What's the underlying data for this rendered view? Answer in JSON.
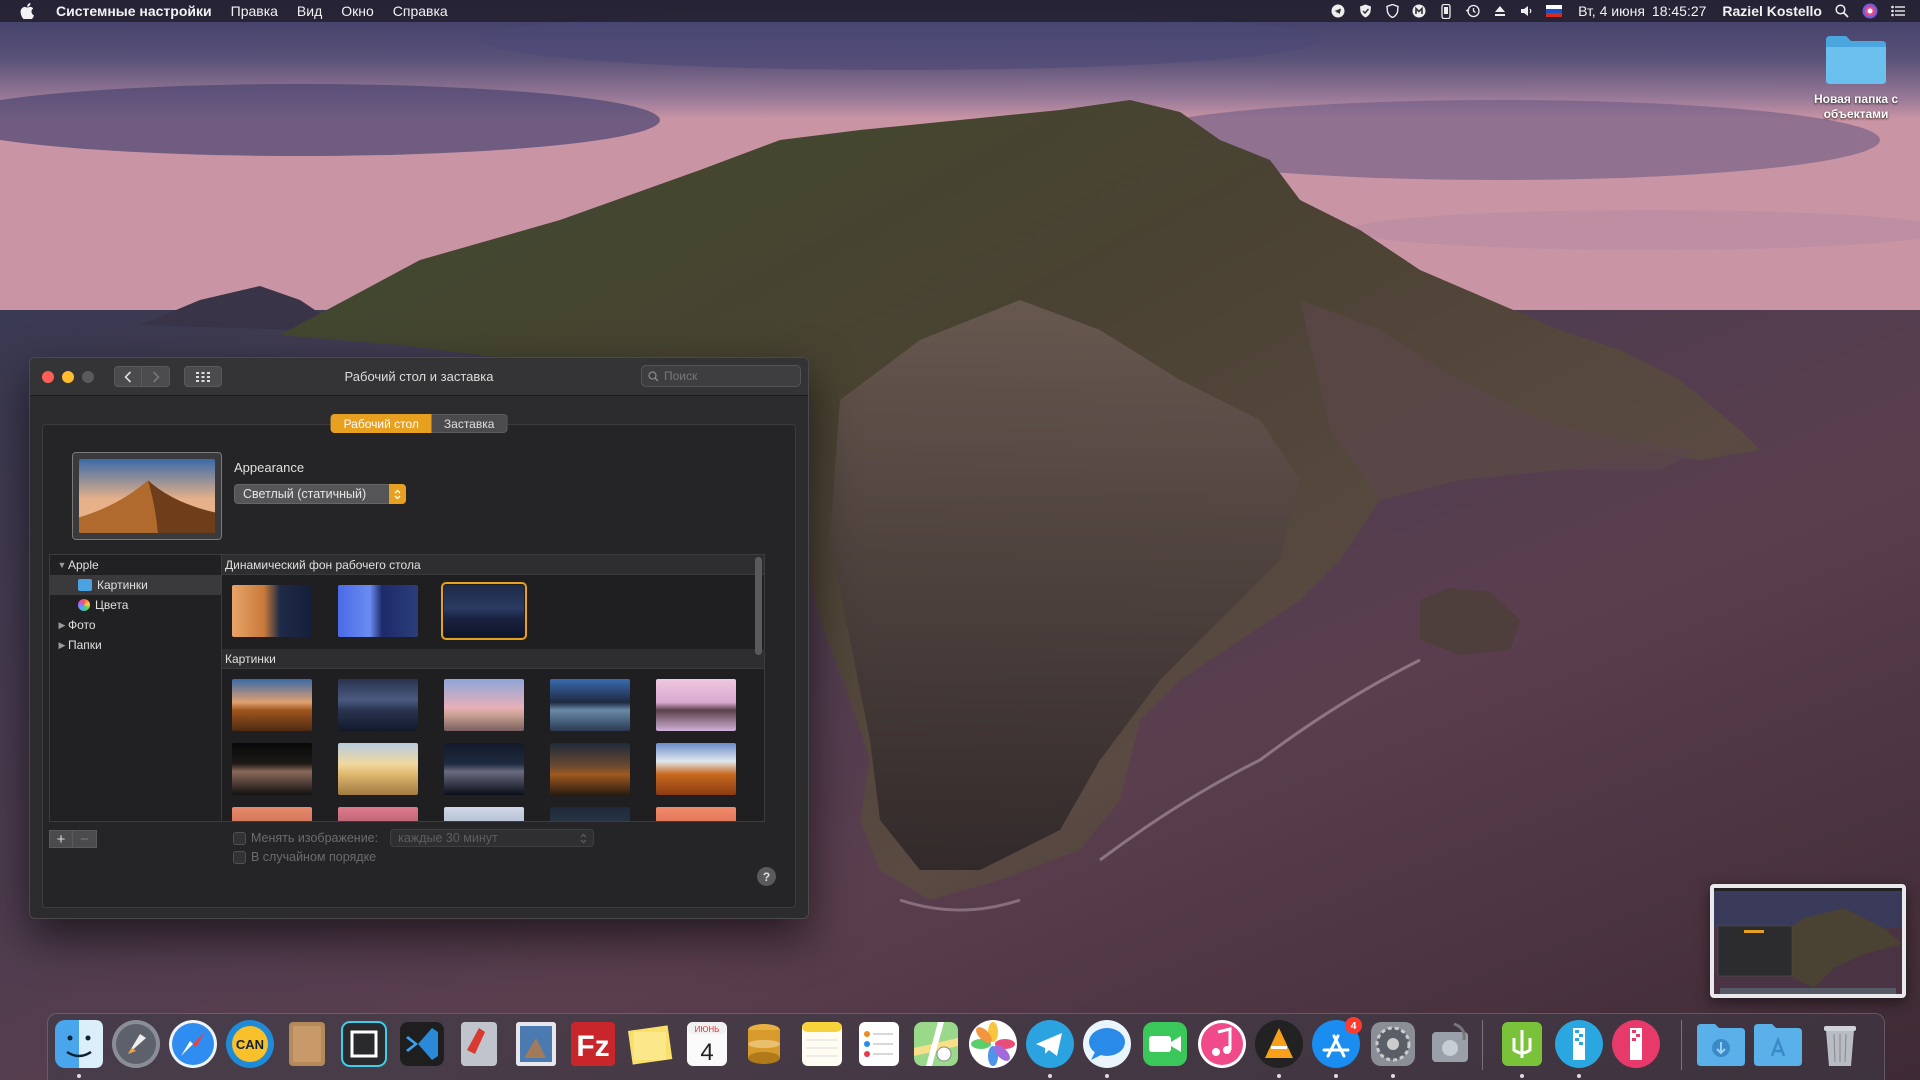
{
  "menubar": {
    "app_name": "Системные настройки",
    "menus": [
      "Правка",
      "Вид",
      "Окно",
      "Справка"
    ],
    "status_icons": [
      "telegram-icon",
      "shield-check-icon",
      "shield-icon",
      "malwarebytes-icon",
      "phone-icon",
      "time-machine-icon",
      "eject-icon",
      "volume-icon",
      "russian-flag-icon"
    ],
    "date": "Вт, 4 июня",
    "time": "18:45:27",
    "user": "Raziel Kostello"
  },
  "desktop": {
    "folder_label": "Новая папка с объектами"
  },
  "window": {
    "title": "Рабочий стол и заставка",
    "search_placeholder": "Поиск",
    "tabs": [
      {
        "label": "Рабочий стол",
        "active": true
      },
      {
        "label": "Заставка",
        "active": false
      }
    ],
    "appearance_label": "Appearance",
    "appearance_value": "Светлый (статичный)",
    "sidebar": [
      {
        "label": "Apple",
        "expanded": true,
        "level": 0
      },
      {
        "label": "Картинки",
        "selected": true,
        "level": 1,
        "icon": "folder-icon"
      },
      {
        "label": "Цвета",
        "level": 1,
        "icon": "color-wheel-icon"
      },
      {
        "label": "Фото",
        "expanded": false,
        "level": 0
      },
      {
        "label": "Папки",
        "expanded": false,
        "level": 0
      }
    ],
    "sections": {
      "dynamic": "Динамический фон рабочего стола",
      "pictures": "Картинки"
    },
    "change_picture_label": "Менять изображение:",
    "interval_value": "каждые 30 минут",
    "random_order_label": "В случайном порядке",
    "add_label": "+",
    "remove_label": "−",
    "help_label": "?"
  },
  "dock": {
    "badge_count": "4",
    "apps": [
      "finder-icon",
      "launchpad-icon",
      "safari-icon",
      "can-icon",
      "notes-book-icon",
      "framer-icon",
      "vscode-icon",
      "script-editor-icon",
      "preview-icon",
      "filezilla-icon",
      "stickies-icon",
      "calendar-icon",
      "sequel-pro-icon",
      "notes-icon",
      "reminders-icon",
      "maps-icon",
      "photos-icon",
      "telegram-icon",
      "messages-icon",
      "facetime-icon",
      "itunes-icon",
      "vlc-icon",
      "app-store-icon",
      "system-preferences-icon",
      "disk-utility-icon",
      "android-file-transfer-icon",
      "archiver-icon",
      "zip-icon",
      "downloads-folder-icon",
      "applications-folder-icon",
      "trash-icon"
    ],
    "calendar_day": "4",
    "calendar_month": "ИЮНЬ"
  }
}
